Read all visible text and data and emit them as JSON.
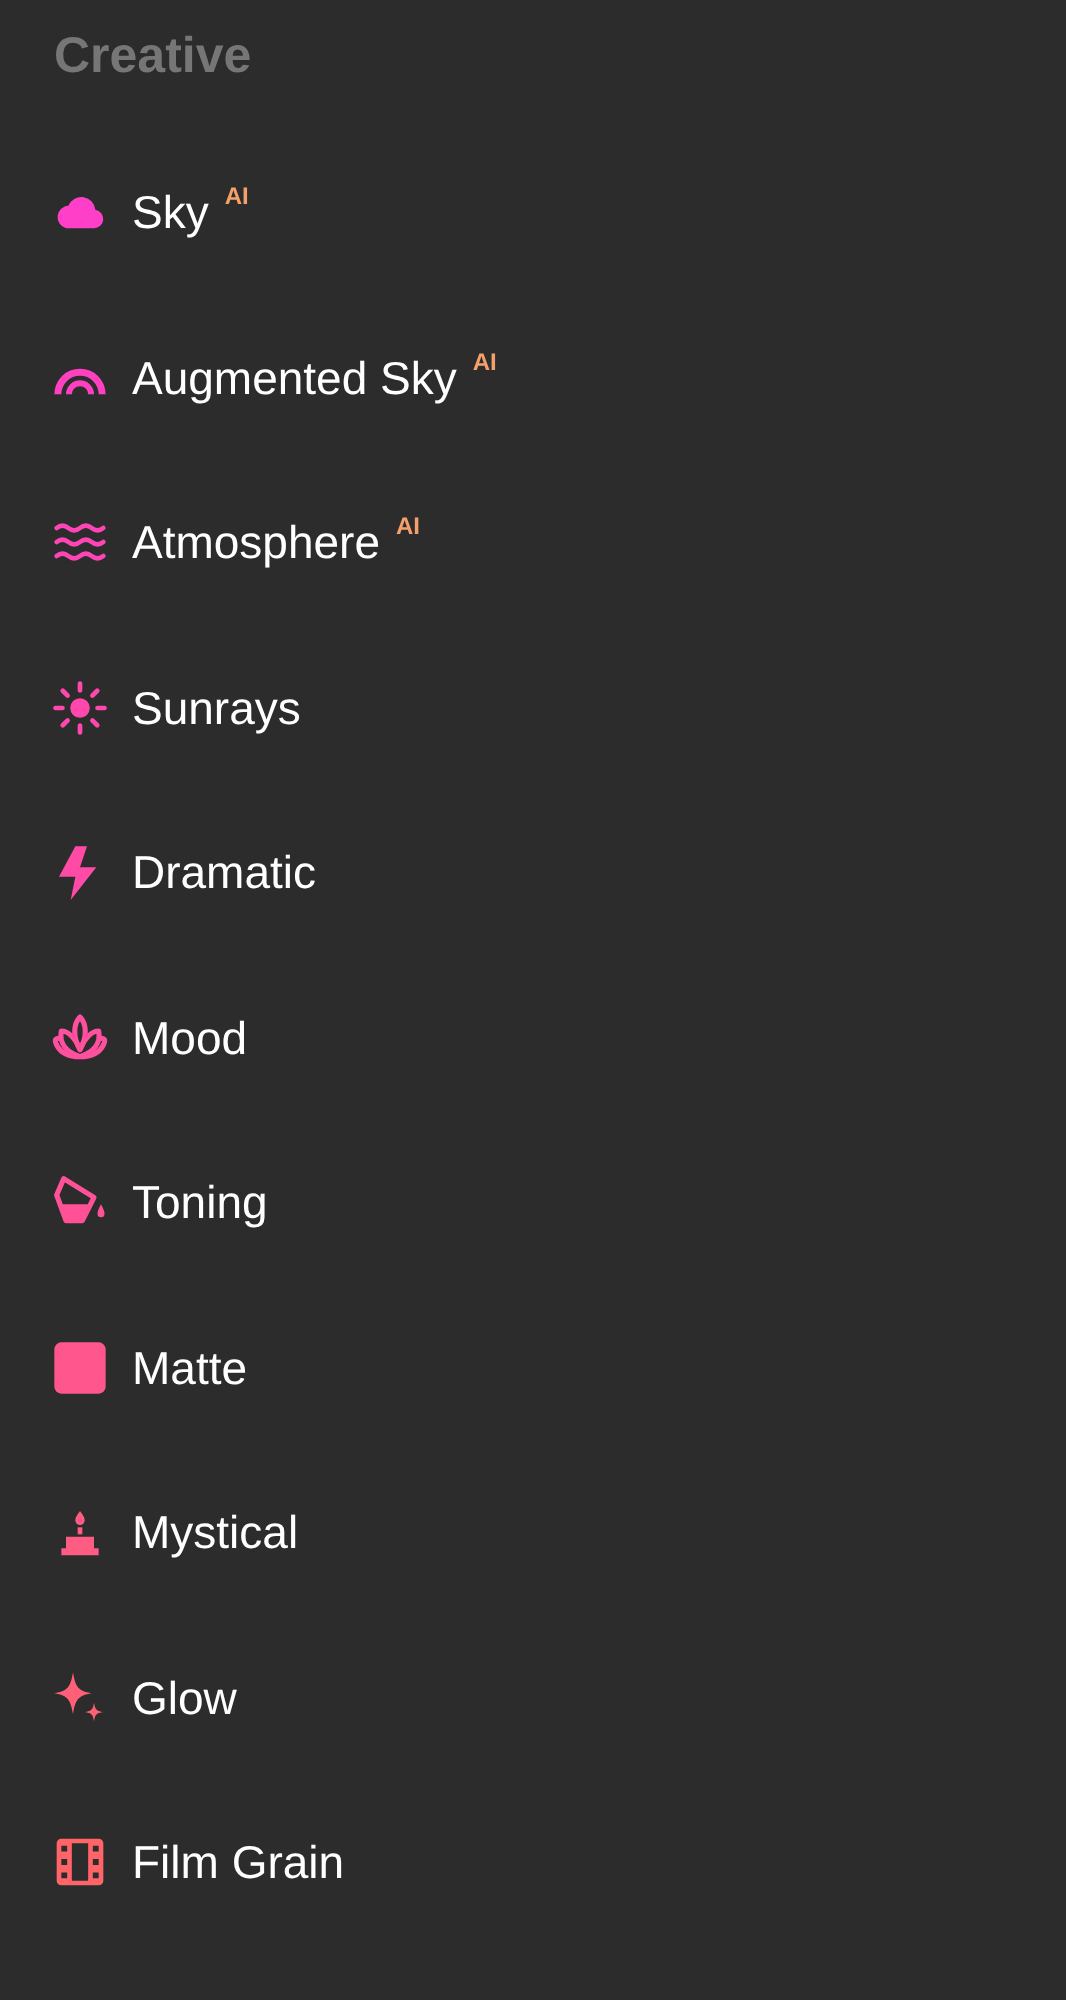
{
  "section": {
    "title": "Creative"
  },
  "items": [
    {
      "label": "Sky",
      "badge": "AI",
      "kind": "cloud",
      "color": "#ff3fc8"
    },
    {
      "label": "Augmented Sky",
      "badge": "AI",
      "kind": "rainbow",
      "color": "#ff40c0"
    },
    {
      "label": "Atmosphere",
      "badge": "AI",
      "kind": "waves",
      "color": "#ff44b6"
    },
    {
      "label": "Sunrays",
      "kind": "sun",
      "color": "#ff47ae"
    },
    {
      "label": "Dramatic",
      "kind": "bolt",
      "color": "#ff4aa6"
    },
    {
      "label": "Mood",
      "kind": "lotus",
      "color": "#ff4f9e"
    },
    {
      "label": "Toning",
      "kind": "bucket",
      "color": "#ff5296"
    },
    {
      "label": "Matte",
      "kind": "square",
      "color": "#ff578d"
    },
    {
      "label": "Mystical",
      "kind": "candle",
      "color": "#ff5c84"
    },
    {
      "label": "Glow",
      "kind": "sparkle",
      "color": "#ff6078"
    },
    {
      "label": "Film Grain",
      "kind": "film",
      "color": "#ff6468"
    }
  ]
}
